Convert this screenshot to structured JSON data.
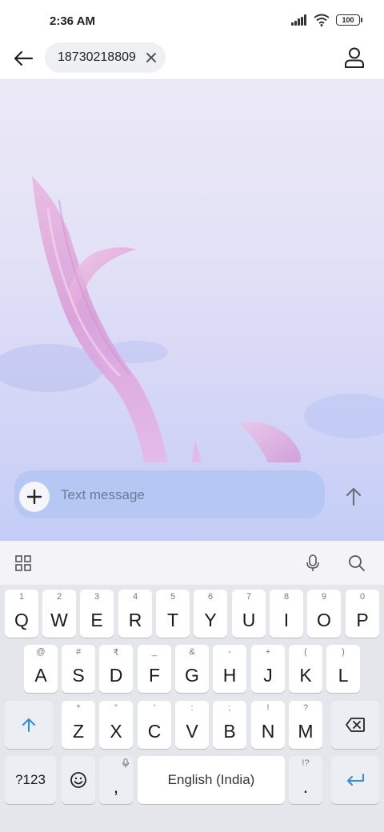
{
  "status_bar": {
    "time": "2:36 AM",
    "battery": "100"
  },
  "top_bar": {
    "recipient": "18730218809"
  },
  "compose": {
    "placeholder": "Text message"
  },
  "keyboard": {
    "row1": [
      {
        "label": "Q",
        "hint": "1"
      },
      {
        "label": "W",
        "hint": "2"
      },
      {
        "label": "E",
        "hint": "3"
      },
      {
        "label": "R",
        "hint": "4"
      },
      {
        "label": "T",
        "hint": "5"
      },
      {
        "label": "Y",
        "hint": "6"
      },
      {
        "label": "U",
        "hint": "7"
      },
      {
        "label": "I",
        "hint": "8"
      },
      {
        "label": "O",
        "hint": "9"
      },
      {
        "label": "P",
        "hint": "0"
      }
    ],
    "row2": [
      {
        "label": "A",
        "hint": "@"
      },
      {
        "label": "S",
        "hint": "#"
      },
      {
        "label": "D",
        "hint": "₹"
      },
      {
        "label": "F",
        "hint": "_"
      },
      {
        "label": "G",
        "hint": "&"
      },
      {
        "label": "H",
        "hint": "-"
      },
      {
        "label": "J",
        "hint": "+"
      },
      {
        "label": "K",
        "hint": "("
      },
      {
        "label": "L",
        "hint": ")"
      }
    ],
    "row3": [
      {
        "label": "Z",
        "hint": "*"
      },
      {
        "label": "X",
        "hint": "\""
      },
      {
        "label": "C",
        "hint": "'"
      },
      {
        "label": "V",
        "hint": ":"
      },
      {
        "label": "B",
        "hint": ";"
      },
      {
        "label": "N",
        "hint": "!"
      },
      {
        "label": "M",
        "hint": "?"
      }
    ],
    "symbols_label": "?123",
    "comma_label": ",",
    "space_label": "English (India)",
    "period_label": ".",
    "period_hint": "!?"
  },
  "colors": {
    "accent": "#2a8fd8",
    "compose_bg": "#b7c7f3"
  }
}
